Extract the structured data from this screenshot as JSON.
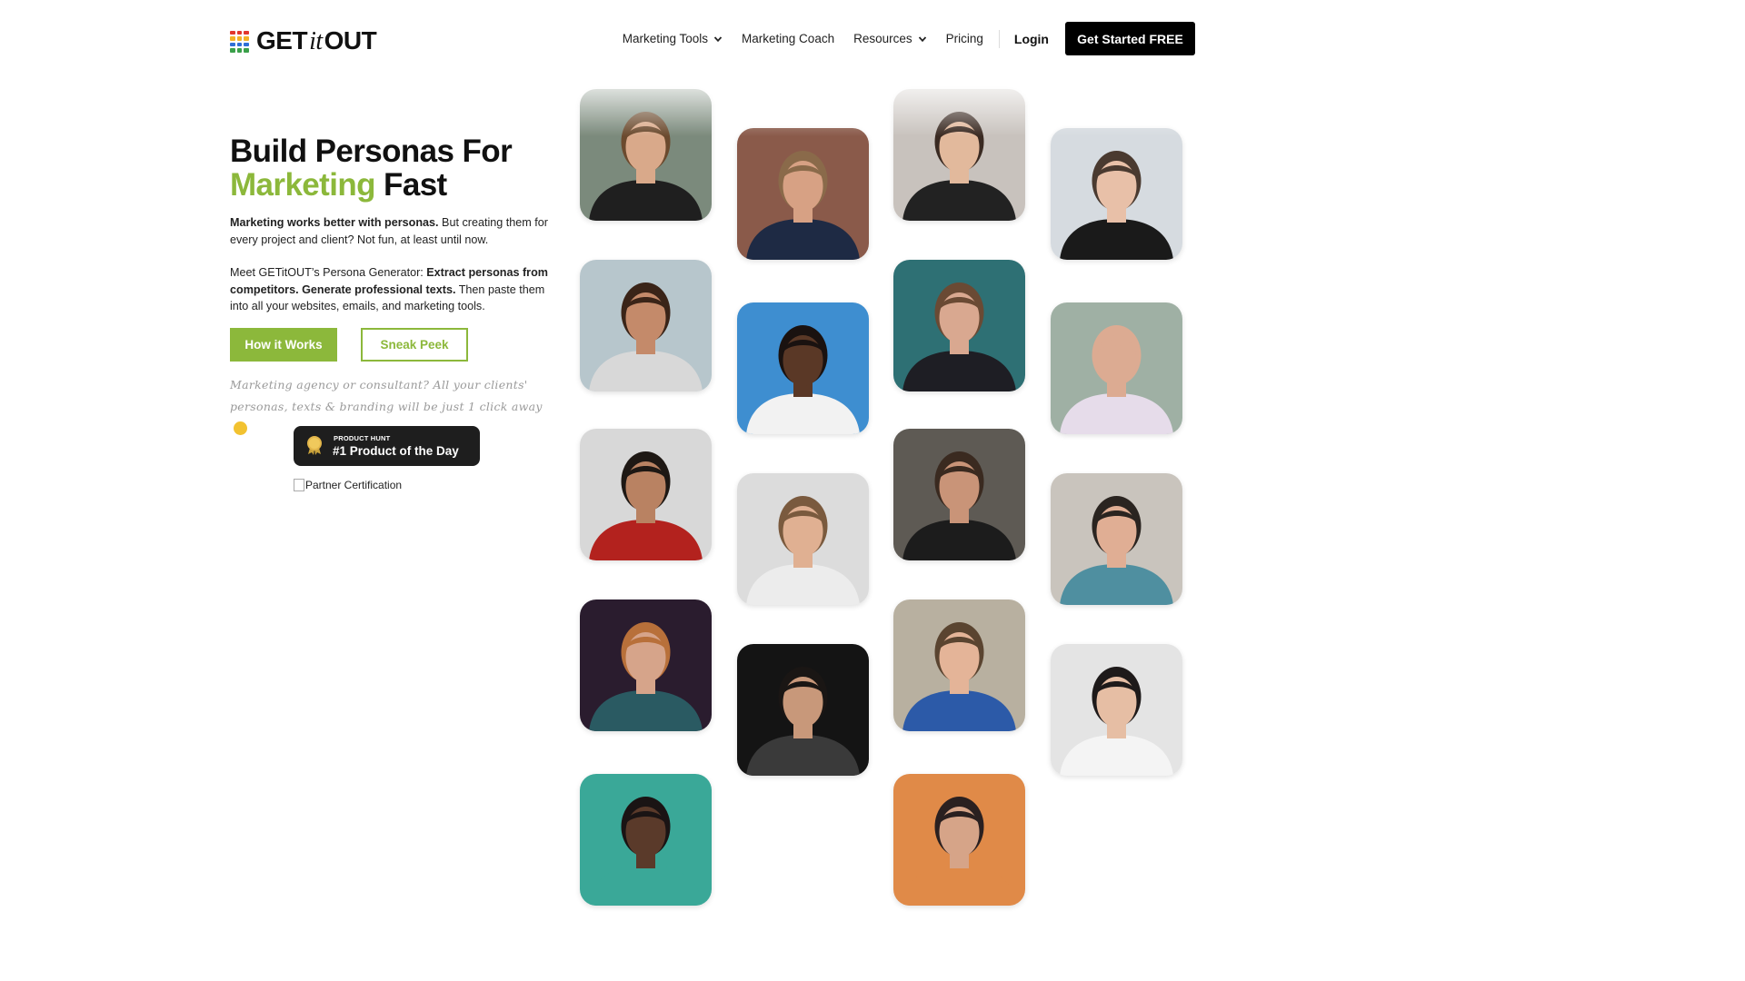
{
  "brand": {
    "name_pre": "GET",
    "name_it": "it",
    "name_post": "OUT",
    "accent": "#8cb83b"
  },
  "nav": {
    "items": [
      {
        "label": "Marketing Tools",
        "dropdown": true
      },
      {
        "label": "Marketing Coach",
        "dropdown": false
      },
      {
        "label": "Resources",
        "dropdown": true
      },
      {
        "label": "Pricing",
        "dropdown": false
      }
    ],
    "login": "Login",
    "cta": "Get Started FREE"
  },
  "hero": {
    "title_line1": "Build Personas For",
    "title_accent": "Marketing",
    "title_end": "Fast",
    "p1_bold": "Marketing works better with personas.",
    "p1_rest": "But creating them for every project and client? Not fun, at least until now.",
    "p2_start": "Meet GETitOUT’s Persona Generator:",
    "p2_bold": "Extract personas from competitors. Generate professional texts.",
    "p2_rest": "Then paste them into all your websites, emails, and marketing tools.",
    "btn_primary": "How it Works",
    "btn_secondary": "Sneak Peek",
    "handwritten": "Marketing agency or consultant? All your clients' personas, texts & branding will be just 1 click away"
  },
  "badge": {
    "small": "PRODUCT HUNT",
    "big": "#1 Product of the Day",
    "medal_number": "1"
  },
  "partner_alt": "Partner Certification",
  "photos": [
    {
      "name": "persona-photo-woman-glasses-long-hair",
      "bg": "#7b8a7c",
      "skin": "#d9a98a",
      "hair": "#6b4a2e",
      "shirt": "#1f1f1f"
    },
    {
      "name": "persona-photo-man-suit-brick-wall",
      "bg": "#8a5a4a",
      "skin": "#d7a184",
      "hair": "#8a6a4a",
      "shirt": "#1e2a44"
    },
    {
      "name": "persona-photo-woman-glasses-leather-jacket",
      "bg": "#c8c2bd",
      "skin": "#e2b99c",
      "hair": "#3a2a22",
      "shirt": "#222222"
    },
    {
      "name": "persona-photo-man-glasses-black-blazer",
      "bg": "#d6dbe0",
      "skin": "#e8c0a8",
      "hair": "#4a3a30",
      "shirt": "#1a1a1a"
    },
    {
      "name": "persona-photo-woman-curly-hair-striped-blazer",
      "bg": "#b7c6cc",
      "skin": "#c48a6a",
      "hair": "#3a2418",
      "shirt": "#d8d8d8"
    },
    {
      "name": "persona-photo-man-smiling-white-shirt-blue",
      "bg": "#3e8ed0",
      "skin": "#5a3826",
      "hair": "#1a1210",
      "shirt": "#f2f2f2"
    },
    {
      "name": "persona-photo-man-beard-glasses-teal",
      "bg": "#2e7074",
      "skin": "#d9a890",
      "hair": "#6a4a34",
      "shirt": "#1e1e24"
    },
    {
      "name": "persona-photo-bald-man-tie",
      "bg": "#9fb0a4",
      "skin": "#dcab92",
      "hair": "#dcab92",
      "shirt": "#e6dcea"
    },
    {
      "name": "persona-photo-man-red-shirt-glasses",
      "bg": "#d8d8d8",
      "skin": "#b98262",
      "hair": "#1e1814",
      "shirt": "#b3221e"
    },
    {
      "name": "persona-photo-man-glasses-hoodie",
      "bg": "#dcdcdc",
      "skin": "#e0b092",
      "hair": "#7a5a3e",
      "shirt": "#ececec"
    },
    {
      "name": "persona-photo-man-beard-black-tshirt",
      "bg": "#5e5a54",
      "skin": "#c99478",
      "hair": "#3a2a20",
      "shirt": "#1c1c1c"
    },
    {
      "name": "persona-photo-man-denim-shirt",
      "bg": "#c9c4bd",
      "skin": "#e0ae94",
      "hair": "#2a2420",
      "shirt": "#4f8fa0"
    },
    {
      "name": "persona-photo-woman-red-curly-hair",
      "bg": "#2a1c2e",
      "skin": "#d6a48a",
      "hair": "#b8703a",
      "shirt": "#2a5a62"
    },
    {
      "name": "persona-photo-man-dark-grey-coat",
      "bg": "#141414",
      "skin": "#c8987a",
      "hair": "#1a1614",
      "shirt": "#3a3a3a"
    },
    {
      "name": "persona-photo-man-blue-blazer",
      "bg": "#b8b0a0",
      "skin": "#e4b498",
      "hair": "#5a4430",
      "shirt": "#2c5aa8"
    },
    {
      "name": "persona-photo-woman-bun-white-tshirt",
      "bg": "#e4e4e4",
      "skin": "#e6bea4",
      "hair": "#1e1a1a",
      "shirt": "#f4f4f4"
    },
    {
      "name": "persona-photo-woman-teal-partial",
      "bg": "#3aa898",
      "skin": "#5a3a2a",
      "hair": "#1a1414",
      "shirt": "#3aa898"
    },
    {
      "name": "persona-photo-woman-orange-partial",
      "bg": "#e08a48",
      "skin": "#d6a488",
      "hair": "#2a2020",
      "shirt": "#e08a48"
    }
  ]
}
